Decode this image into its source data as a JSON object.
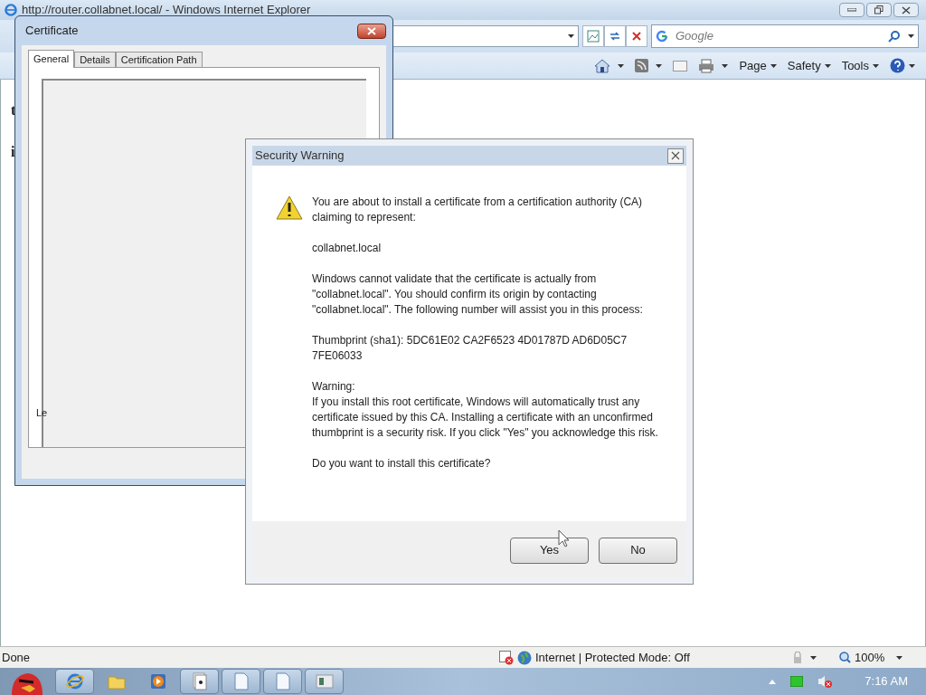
{
  "browser": {
    "title": "http://router.collabnet.local/ - Windows Internet Explorer",
    "search": {
      "placeholder": "Google"
    },
    "commands": [
      {
        "label": "Page"
      },
      {
        "label": "Safety"
      },
      {
        "label": "Tools"
      }
    ],
    "page_fragments": [
      {
        "text": "t"
      },
      {
        "text": "i"
      }
    ],
    "status": {
      "text": "Done",
      "zone": "Internet | Protected Mode: Off",
      "zoom": "100%"
    }
  },
  "certificate_dialog": {
    "title": "Certificate",
    "tabs": [
      {
        "label": "General",
        "selected": true
      },
      {
        "label": "Details",
        "selected": false
      },
      {
        "label": "Certification Path",
        "selected": false
      }
    ],
    "fragment": "Le"
  },
  "security_warning": {
    "title": "Security Warning",
    "paragraphs": [
      {
        "text": "You are about to install a certificate from a certification authority (CA) claiming to represent:",
        "kind": "plain"
      },
      {
        "text": "collabnet.local",
        "kind": "plain"
      },
      {
        "text": "Windows cannot validate that the certificate is actually from \"collabnet.local\". You should confirm its origin by contacting \"collabnet.local\". The following number will assist you in this process:",
        "kind": "plain"
      },
      {
        "text": "Thumbprint (sha1): 5DC61E02 CA2F6523 4D01787D AD6D05C7 7FE06033",
        "kind": "plain"
      },
      {
        "text": "Warning:",
        "kind": "label"
      },
      {
        "text": "If you install this root certificate, Windows will automatically trust any certificate issued by this CA. Installing a certificate with an unconfirmed thumbprint is a security risk. If you click \"Yes\" you acknowledge this risk.",
        "kind": "plain"
      },
      {
        "text": "Do you want to install this certificate?",
        "kind": "plain"
      }
    ],
    "buttons": [
      {
        "label": "Yes"
      },
      {
        "label": "No"
      }
    ]
  },
  "taskbar": {
    "items": [
      {
        "kind": "browser",
        "running": true
      },
      {
        "kind": "folder",
        "running": false
      },
      {
        "kind": "media",
        "running": false
      },
      {
        "kind": "cards",
        "running": true
      },
      {
        "kind": "document",
        "running": true
      },
      {
        "kind": "document",
        "running": true
      },
      {
        "kind": "window",
        "running": true
      }
    ],
    "clock": "7:16 AM"
  }
}
